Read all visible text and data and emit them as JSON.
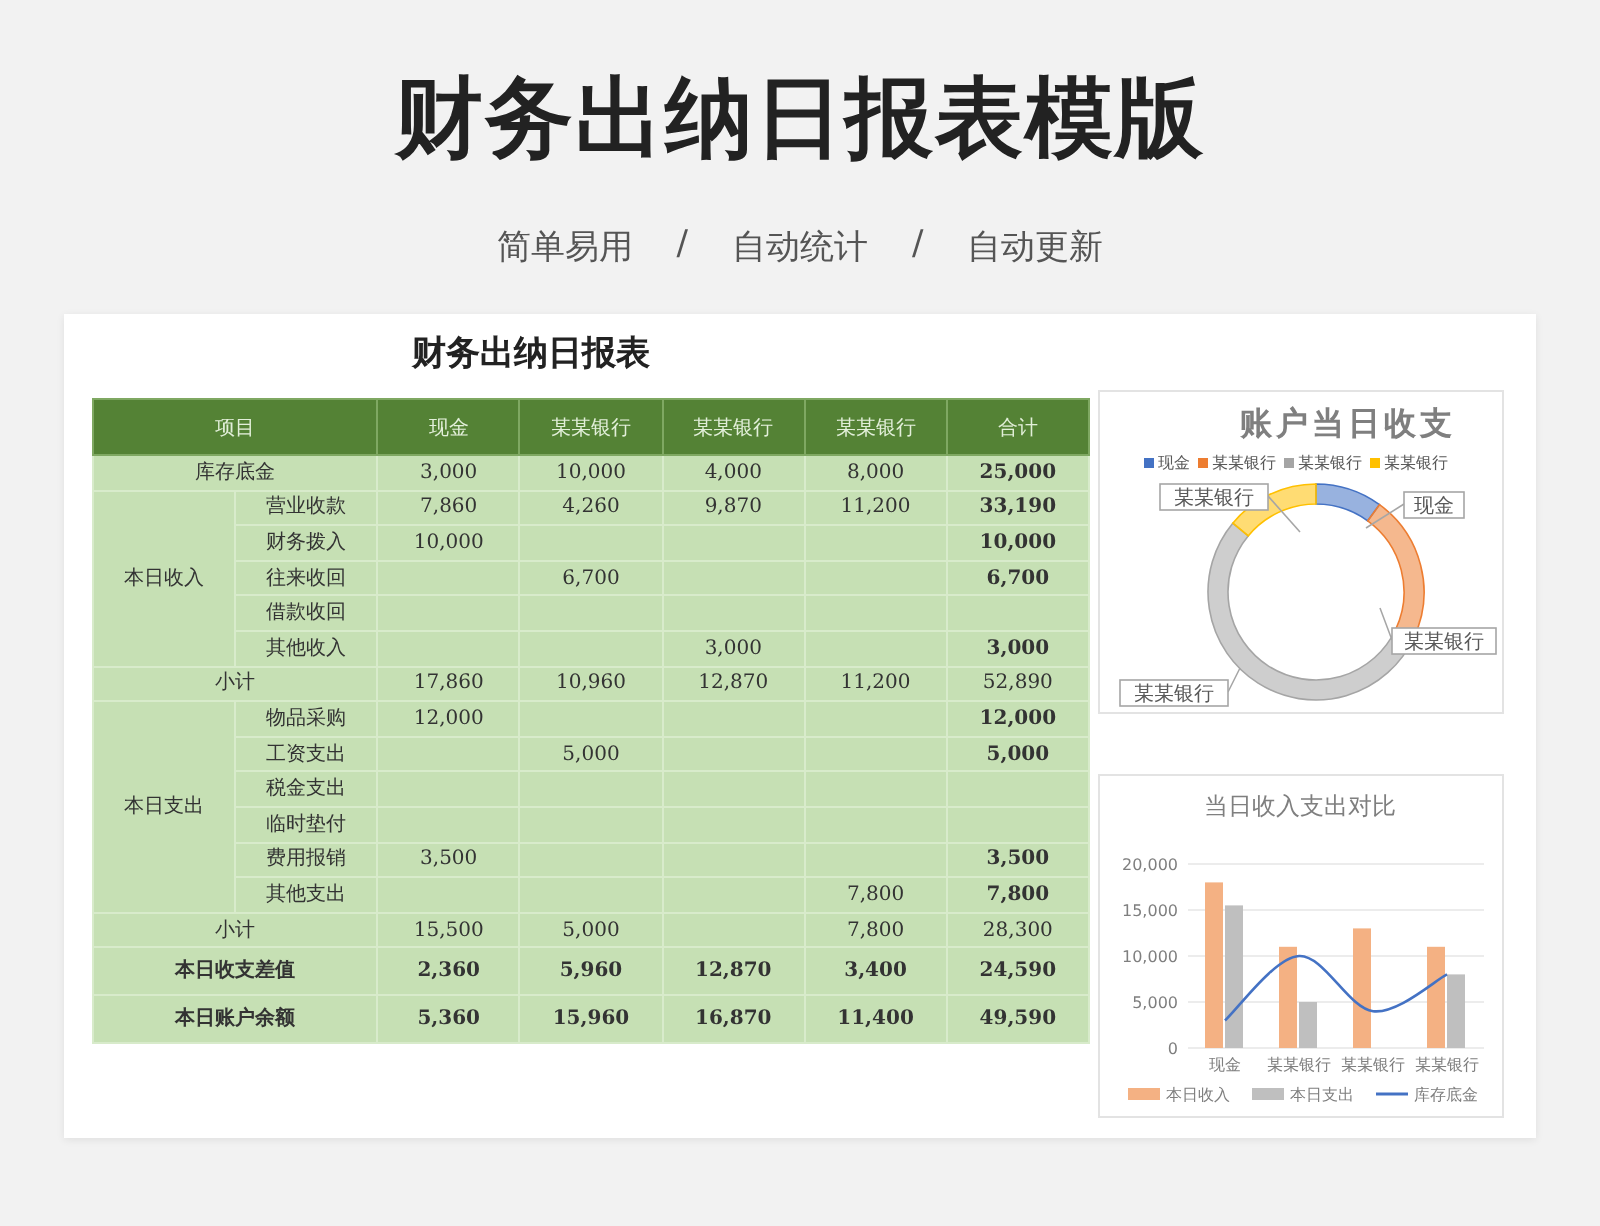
{
  "page": {
    "title": "财务出纳日报表模版",
    "tagline": [
      "简单易用",
      "/",
      "自动统计",
      "/",
      "自动更新"
    ]
  },
  "sheet": {
    "title": "财务出纳日报表",
    "columns": [
      "项目",
      "现金",
      "某某银行",
      "某某银行",
      "某某银行",
      "合计"
    ],
    "sections": [
      {
        "kind": "row",
        "label": "库存底金",
        "values": {
          "cash": "3,000",
          "bank_1": "10,000",
          "bank_2": "4,000",
          "bank_3": "8,000"
        },
        "total": "25,000"
      },
      {
        "kind": "group",
        "label": "本日收入",
        "items": [
          {
            "label": "营业收款",
            "values": {
              "cash": "7,860",
              "bank_1": "4,260",
              "bank_2": "9,870",
              "bank_3": "11,200"
            },
            "total": "33,190"
          },
          {
            "label": "财务拨入",
            "values": {
              "cash": "10,000"
            },
            "total": "10,000"
          },
          {
            "label": "往来收回",
            "values": {
              "bank_1": "6,700"
            },
            "total": "6,700"
          },
          {
            "label": "借款收回"
          },
          {
            "label": "其他收入",
            "values": {
              "bank_2": "3,000"
            },
            "total": "3,000"
          }
        ]
      },
      {
        "kind": "subtotal",
        "label": "小计",
        "values": {
          "cash": "17,860",
          "bank_1": "10,960",
          "bank_2": "12,870",
          "bank_3": "11,200"
        },
        "total": "52,890"
      },
      {
        "kind": "group",
        "label": "本日支出",
        "items": [
          {
            "label": "物品采购",
            "values": {
              "cash": "12,000"
            },
            "total": "12,000"
          },
          {
            "label": "工资支出",
            "values": {
              "bank_1": "5,000"
            },
            "total": "5,000"
          },
          {
            "label": "税金支出"
          },
          {
            "label": "临时垫付"
          },
          {
            "label": "费用报销",
            "values": {
              "cash": "3,500"
            },
            "total": "3,500"
          },
          {
            "label": "其他支出",
            "values": {
              "bank_3": "7,800"
            },
            "total": "7,800"
          }
        ]
      },
      {
        "kind": "subtotal",
        "label": "小计",
        "values": {
          "cash": "15,500",
          "bank_1": "5,000",
          "bank_3": "7,800"
        },
        "total": "28,300"
      },
      {
        "kind": "summary",
        "label": "本日收支差值",
        "values": {
          "cash": "2,360",
          "bank_1": "5,960",
          "bank_2": "12,870",
          "bank_3": "3,400"
        },
        "total": "24,590"
      },
      {
        "kind": "summary",
        "label": "本日账户余额",
        "values": {
          "cash": "5,360",
          "bank_1": "15,960",
          "bank_2": "16,870",
          "bank_3": "11,400"
        },
        "total": "49,590"
      }
    ]
  },
  "donut": {
    "title": "账户当日收支",
    "legend": [
      {
        "label": "现金",
        "color": "#4472c4"
      },
      {
        "label": "某某银行",
        "color": "#ed7d31"
      },
      {
        "label": "某某银行",
        "color": "#a5a5a5"
      },
      {
        "label": "某某银行",
        "color": "#ffc000"
      }
    ],
    "callouts": [
      "某某银行",
      "现金",
      "某某银行",
      "某某银行"
    ]
  },
  "bar_chart": {
    "chart_data": {
      "type": "bar",
      "title": "当日收入支出对比",
      "categories": [
        "现金",
        "某某银行",
        "某某银行",
        "某某银行"
      ],
      "series": [
        {
          "name": "本日收入",
          "color": "#f4b183",
          "values": [
            18000,
            11000,
            13000,
            11000
          ]
        },
        {
          "name": "本日支出",
          "color": "#bfbfbf",
          "values": [
            15500,
            5000,
            null,
            8000
          ]
        },
        {
          "name": "库存底金",
          "color": "#4472c4",
          "type": "line",
          "values": [
            3000,
            10000,
            4000,
            8000
          ]
        }
      ],
      "grid": true,
      "legend": true,
      "ylim": [
        0,
        20000
      ],
      "yticks": [
        {
          "value": 0,
          "label": "0"
        },
        {
          "value": 5000,
          "label": "5,000"
        },
        {
          "value": 10000,
          "label": "10,000"
        },
        {
          "value": 15000,
          "label": "15,000"
        },
        {
          "value": 20000,
          "label": "20,000"
        }
      ]
    }
  }
}
